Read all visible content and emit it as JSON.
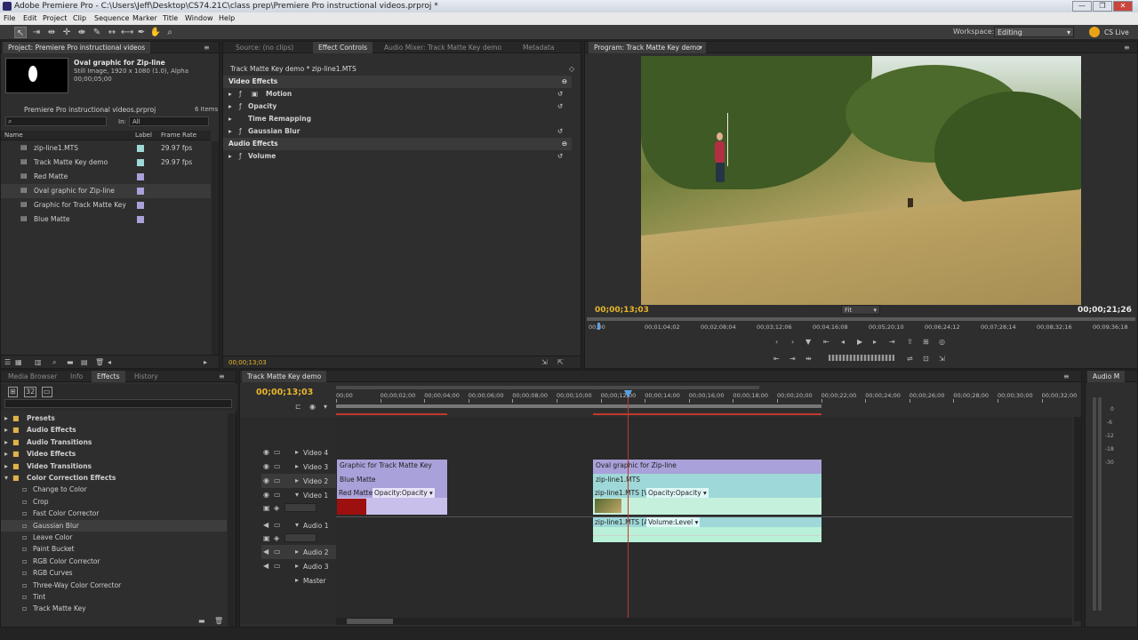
{
  "window": {
    "title": "Adobe Premiere Pro - C:\\Users\\Jeff\\Desktop\\CS74.21C\\class prep\\Premiere Pro instructional videos.prproj *",
    "controls": [
      "—",
      "❐",
      "✕"
    ]
  },
  "menu": [
    "File",
    "Edit",
    "Project",
    "Clip",
    "Sequence",
    "Marker",
    "Title",
    "Window",
    "Help"
  ],
  "toolbar": {
    "workspace_label": "Workspace:",
    "workspace_value": "Editing",
    "cs_live": "CS Live"
  },
  "project_panel": {
    "tab": "Project: Premiere Pro instructional videos",
    "preview": {
      "name": "Oval graphic for Zip-line",
      "details": "Still Image, 1920 x 1080 (1.0), Alpha",
      "duration": "00;00;05;00"
    },
    "project_file": "Premiere Pro instructional videos.prproj",
    "item_count": "6 Items",
    "search_placeholder": "",
    "in_label": "In:",
    "in_value": "All",
    "columns": [
      "Name",
      "Label",
      "Frame Rate"
    ],
    "items": [
      {
        "name": "zip-line1.MTS",
        "color": "#9fd8d8",
        "fps": "29.97 fps"
      },
      {
        "name": "Track Matte Key demo",
        "color": "#9fd8d8",
        "fps": "29.97 fps"
      },
      {
        "name": "Red Matte",
        "color": "#a9a1d9",
        "fps": ""
      },
      {
        "name": "Oval graphic for Zip-line",
        "color": "#a9a1d9",
        "fps": ""
      },
      {
        "name": "Graphic for Track Matte Key",
        "color": "#a9a1d9",
        "fps": ""
      },
      {
        "name": "Blue Matte",
        "color": "#a9a1d9",
        "fps": ""
      }
    ]
  },
  "effect_controls": {
    "tabs": [
      "Source: (no clips)",
      "Effect Controls",
      "Audio Mixer: Track Matte Key demo",
      "Metadata"
    ],
    "clip_path": "Track Matte Key demo * zip-line1.MTS",
    "video_effects_label": "Video Effects",
    "audio_effects_label": "Audio Effects",
    "video_effects": [
      "Motion",
      "Opacity",
      "Time Remapping",
      "Gaussian Blur"
    ],
    "audio_effects": [
      "Volume"
    ],
    "timecode": "00;00;13;03"
  },
  "program_monitor": {
    "tab": "Program: Track Matte Key demo",
    "current_timecode": "00;00;13;03",
    "duration_timecode": "00;00;21;26",
    "fit": "Fit",
    "ruler": [
      "00;00",
      "00;01;04;02",
      "00;02;08;04",
      "00;03;12;06",
      "00;04;16;08",
      "00;05;20;10",
      "00;06;24;12",
      "00;07;28;14",
      "00;08;32;16",
      "00;09;36;18"
    ]
  },
  "effects_panel": {
    "tabs": [
      "Media Browser",
      "Info",
      "Effects",
      "History"
    ],
    "folders": [
      "Presets",
      "Audio Effects",
      "Audio Transitions",
      "Video Effects",
      "Video Transitions"
    ],
    "open_folder": "Color Correction Effects",
    "items": [
      "Change to Color",
      "Crop",
      "Fast Color Corrector",
      "Gaussian Blur",
      "Leave Color",
      "Paint Bucket",
      "RGB Color Corrector",
      "RGB Curves",
      "Three-Way Color Corrector",
      "Tint",
      "Track Matte Key"
    ],
    "selected": "Gaussian Blur"
  },
  "timeline": {
    "tab": "Track Matte Key demo",
    "timecode": "00;00;13;03",
    "ruler": [
      "00;00",
      "00;00;02;00",
      "00;00;04;00",
      "00;00;06;00",
      "00;00;08;00",
      "00;00;10;00",
      "00;00;12;00",
      "00;00;14;00",
      "00;00;16;00",
      "00;00;18;00",
      "00;00;20;00",
      "00;00;22;00",
      "00;00;24;00",
      "00;00;26;00",
      "00;00;28;00",
      "00;00;30;00",
      "00;00;32;00"
    ],
    "tracks": {
      "video4": "Video 4",
      "video3": "Video 3",
      "video2": "Video 2",
      "video1": "Video 1",
      "audio1": "Audio 1",
      "audio2": "Audio 2",
      "audio3": "Audio 3",
      "master": "Master"
    },
    "clips": {
      "v3a": "Graphic for Track Matte Key",
      "v3b": "Oval graphic for Zip-line",
      "v2a": "Blue Matte",
      "v2b": "zip-line1.MTS",
      "v1a_name": "Red Matte",
      "v1a_fx": "Opacity:Opacity ▾",
      "v1b_name": "zip-line1.MTS [V]",
      "v1b_fx": "Opacity:Opacity ▾",
      "a1_name": "zip-line1.MTS [A]",
      "a1_fx": "Volume:Level ▾"
    }
  },
  "audio_meter": {
    "tab": "Audio M",
    "scale": [
      "0",
      "-6",
      "-12",
      "-18",
      "-30"
    ]
  }
}
